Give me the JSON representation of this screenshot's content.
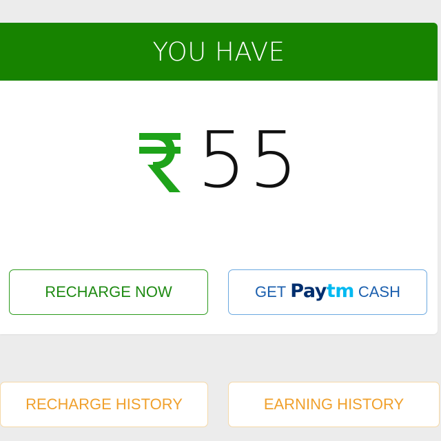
{
  "wallet_card": {
    "header_title": "YOU HAVE",
    "currency_icon": "rupee-icon",
    "amount": "55"
  },
  "actions": {
    "recharge_now_label": "RECHARGE NOW",
    "paytm_prefix": "GET",
    "paytm_logo_pay": "Pay",
    "paytm_logo_tm": "tm",
    "paytm_suffix": "CASH"
  },
  "history": {
    "recharge_history_label": "RECHARGE HISTORY",
    "earning_history_label": "EARNING HISTORY"
  },
  "colors": {
    "header_green": "#178300",
    "recharge_green": "#1e8a12",
    "paytm_blue": "#1b5fae",
    "paytm_navy": "#002e6e",
    "paytm_cyan": "#00b9f1",
    "history_orange": "#f0a02c",
    "background": "#ececec"
  }
}
